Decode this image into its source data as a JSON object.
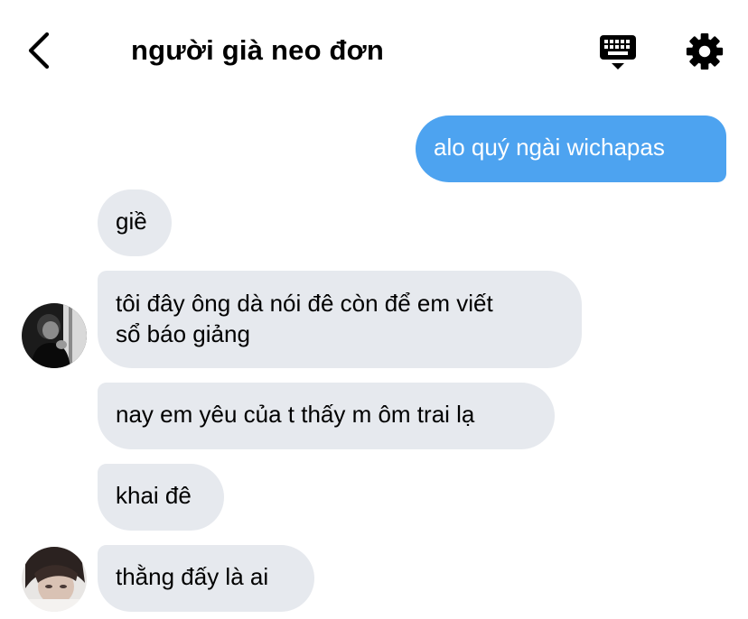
{
  "header": {
    "title": "người già neo đơn",
    "back_icon": "chevron-left-icon",
    "keyboard_icon": "keyboard-icon",
    "settings_icon": "gear-icon"
  },
  "messages": [
    {
      "direction": "outgoing",
      "text": "alo quý ngài wichapas"
    },
    {
      "direction": "incoming",
      "text": "giề"
    },
    {
      "direction": "incoming",
      "lines": [
        "tôi đây ông dà nói đê còn để em viết",
        "sổ báo giảng"
      ]
    },
    {
      "direction": "incoming",
      "text": "nay em yêu của t thấy m ôm trai lạ"
    },
    {
      "direction": "incoming",
      "text": "khai đê"
    },
    {
      "direction": "incoming",
      "text": "thằng đấy là ai"
    }
  ],
  "colors": {
    "outgoing_bubble": "#4da3f0",
    "incoming_bubble": "#e6e9ee",
    "text": "#000000"
  }
}
